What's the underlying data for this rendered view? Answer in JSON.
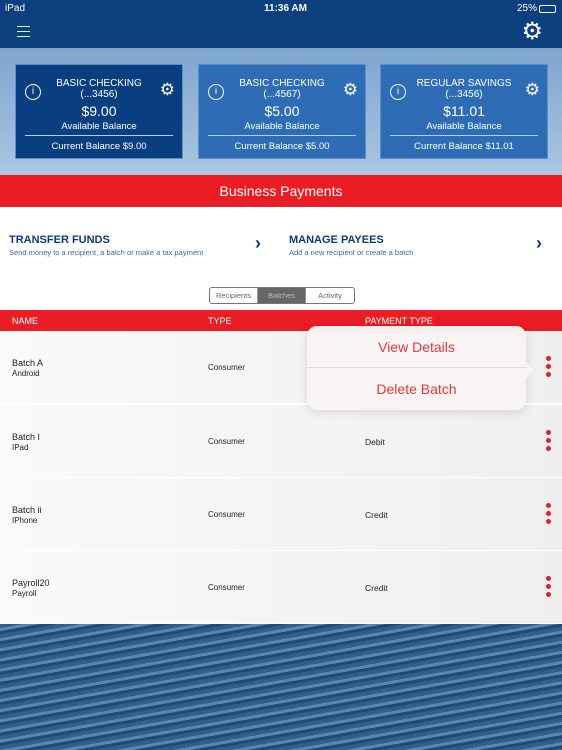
{
  "status": {
    "device": "iPad",
    "time": "11:36 AM",
    "battery": "25%"
  },
  "accounts": [
    {
      "name": "BASIC CHECKING",
      "acct": "(...3456)",
      "amount": "$9.00",
      "avail_label": "Available Balance",
      "current": "Current Balance $9.00",
      "selected": true
    },
    {
      "name": "BASIC CHECKING",
      "acct": "(...4567)",
      "amount": "$5.00",
      "avail_label": "Available Balance",
      "current": "Current Balance $5.00"
    },
    {
      "name": "REGULAR SAVINGS",
      "acct": "(...3456)",
      "amount": "$11.01",
      "avail_label": "Available Balance",
      "current": "Current Balance $11.01"
    }
  ],
  "banner": "Business Payments",
  "actions": [
    {
      "title": "TRANSFER FUNDS",
      "subtitle": "Send money to a recipient, a batch or make a tax payment"
    },
    {
      "title": "MANAGE PAYEES",
      "subtitle": "Add a new recipient or create a batch"
    }
  ],
  "tabs": [
    "Recipients",
    "Batches",
    "Activity"
  ],
  "active_tab": "Batches",
  "table": {
    "headers": [
      "NAME",
      "TYPE",
      "PAYMENT TYPE"
    ],
    "rows": [
      {
        "name": "Batch A",
        "device": "Android",
        "type": "Consumer",
        "payment": ""
      },
      {
        "name": "Batch I",
        "device": "IPad",
        "type": "Consumer",
        "payment": "Debit"
      },
      {
        "name": "Batch ii",
        "device": "IPhone",
        "type": "Consumer",
        "payment": "Credit"
      },
      {
        "name": "Payroll20",
        "device": "Payroll",
        "type": "Consumer",
        "payment": "Credit"
      }
    ]
  },
  "popover": {
    "view": "View Details",
    "delete": "Delete Batch"
  },
  "colors": {
    "navy": "#0b3f7e",
    "red": "#ea1c24",
    "card": "#2e6db5"
  }
}
